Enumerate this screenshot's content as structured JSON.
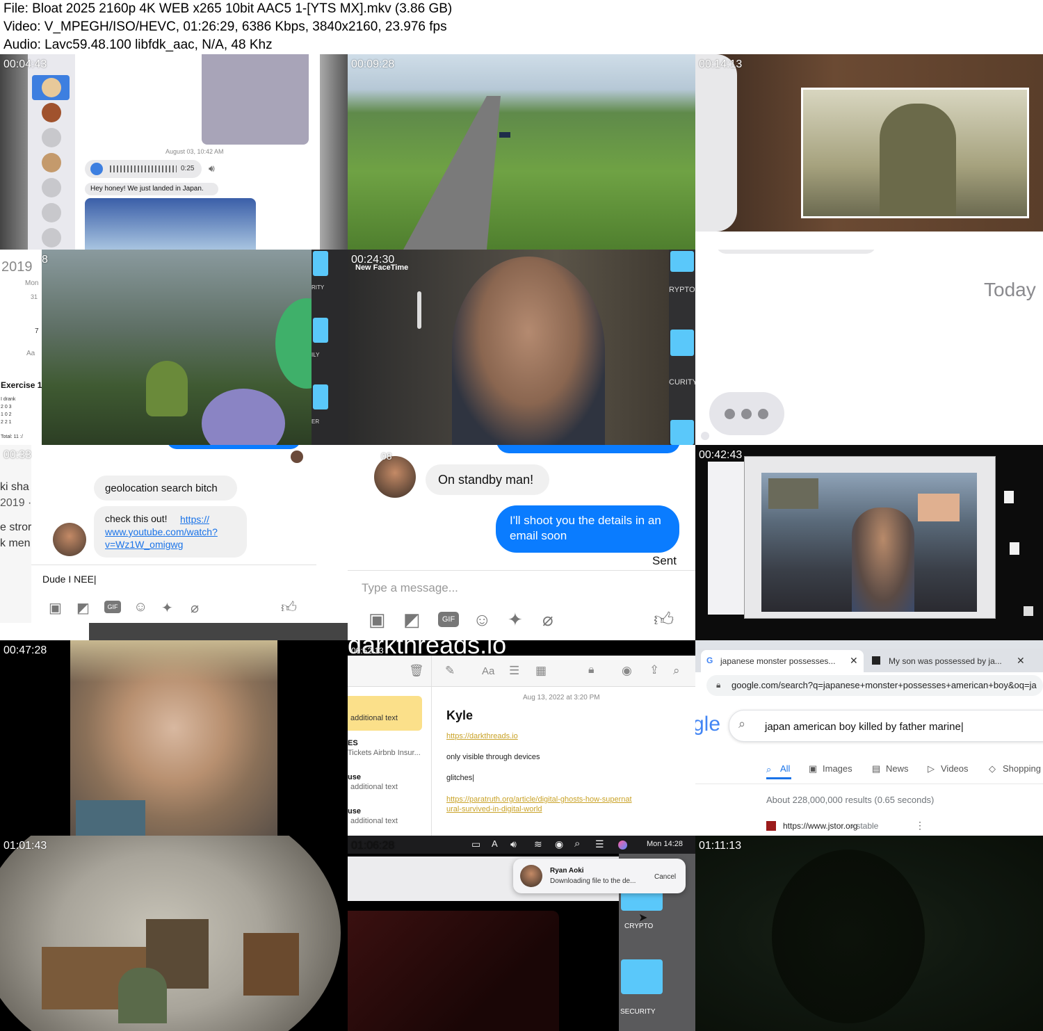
{
  "header": {
    "file_line": "File: Bloat 2025 2160p 4K WEB x265 10bit AAC5 1-[YTS MX].mkv (3.86 GB)",
    "video_line": "Video: V_MPEGH/ISO/HEVC, 01:26:29, 6386 Kbps, 3840x2160, 23.976 fps",
    "audio_line": "Audio: Lavc59.48.100 libfdk_aac, N/A, 48 Khz"
  },
  "tiles": {
    "t1": {
      "time": "00:04:43",
      "msg_timestamp": "August 03, 10:42 AM",
      "audio_duration": "0:25",
      "message": "Hey honey! We just landed in Japan."
    },
    "t2": {
      "time": "00:09:28"
    },
    "t3": {
      "time": "00:14:13"
    },
    "t4": {
      "time": "8",
      "year": "2019",
      "day": "Mon",
      "num_31": "31",
      "num_7": "7",
      "aa": "Aa",
      "exercise": "Exercise 1",
      "drank": "I drank",
      "n1": "2 0 3",
      "n2": "1 0 2",
      "n3": "2 2 1",
      "total": "Total: 11 :/",
      "side1": "RITY",
      "side2": "ILY",
      "side3": "ER"
    },
    "t5": {
      "time": "00:24:30",
      "facetime": "New FaceTime",
      "side1": "RYPTO",
      "side2": "CURITY"
    },
    "t6": {
      "today": "Today"
    },
    "t7": {
      "time": "00:33",
      "left1": "ki sha",
      "left2": "2019 ·",
      "left3": "e stror",
      "left4": "k men",
      "bubble1": "geolocation search bitch",
      "bubble2_text": "check this out!",
      "bubble2_link": "https:// www.youtube.com/watch? v=Wz1W_omigwg",
      "input": "Dude I NEE|"
    },
    "t8": {
      "time": "08",
      "bubble_in": "On standby man!",
      "bubble_out": "I'll shoot you the details in an email soon",
      "sent": "Sent",
      "placeholder": "Type a message..."
    },
    "t9": {
      "time": "00:42:43"
    },
    "t10": {
      "time": "00:47:28"
    },
    "t11": {
      "time": "00:52:13",
      "banner": "darkthreads.io",
      "date": "Aug 13, 2022 at 3:20 PM",
      "title": "Kyle",
      "link1": "https://darkthreads.io",
      "line1": "only visible through devices",
      "line2": "glitches|",
      "link2": "https://paratruth.org/article/digital-ghosts-how-supernatural-survived-in-digital-world",
      "list1": "additional text",
      "list2_title": "ES",
      "list2_sub": "Tickets Airbnb Insur...",
      "list3_title": "use",
      "list3_sub": "additional text",
      "list4_title": "use",
      "list4_sub": "additional text"
    },
    "t12": {
      "tab1": "japanese monster possesses...",
      "tab2": "My son was possessed by ja...",
      "url": "google.com/search?q=japanese+monster+possesses+american+boy&oq=ja",
      "logo": "gle",
      "query": "japan american boy killed by father marine|",
      "nav_all": "All",
      "nav_images": "Images",
      "nav_news": "News",
      "nav_videos": "Videos",
      "nav_shopping": "Shopping",
      "results": "About 228,000,000 results (0.65 seconds)",
      "result_url": "https://www.jstor.org",
      "result_suffix": "› stable"
    },
    "t13": {
      "time": "01:01:43"
    },
    "t14": {
      "time": "01:06:28",
      "clock": "Mon 14:28",
      "notif_name": "Ryan Aoki",
      "notif_text": "Downloading file to the de...",
      "notif_cancel": "Cancel",
      "folder1": "CRYPTO",
      "folder2": "SECURITY"
    },
    "t15": {
      "time": "01:11:13"
    }
  }
}
